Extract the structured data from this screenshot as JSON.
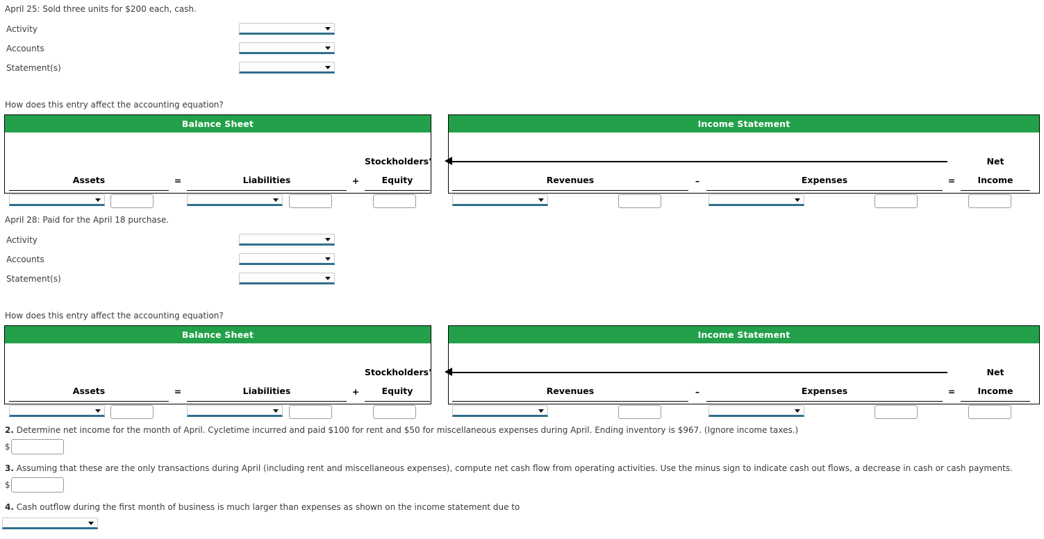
{
  "theme": {
    "header_green": "#22a14a",
    "select_underline": "#2e6e8e",
    "text": "#3a3a3a"
  },
  "transactions": [
    {
      "title": "April 25: Sold three units for $200 each, cash.",
      "fields": [
        {
          "label": "Activity",
          "value": "",
          "icon": "chevron-down-icon"
        },
        {
          "label": "Accounts",
          "value": "",
          "icon": "chevron-down-icon"
        },
        {
          "label": "Statement(s)",
          "value": "",
          "icon": "chevron-down-icon"
        }
      ],
      "prompt": "How does this entry affect the accounting equation?"
    },
    {
      "title": "April 28: Paid for the April 18 purchase.",
      "fields": [
        {
          "label": "Activity",
          "value": "",
          "icon": "chevron-down-icon"
        },
        {
          "label": "Accounts",
          "value": "",
          "icon": "chevron-down-icon"
        },
        {
          "label": "Statement(s)",
          "value": "",
          "icon": "chevron-down-icon"
        }
      ],
      "prompt": "How does this entry affect the accounting equation?"
    }
  ],
  "equation_table": {
    "balance_sheet": {
      "header": "Balance Sheet",
      "columns": [
        {
          "label": "Assets",
          "line1": "",
          "line2": "Assets"
        },
        {
          "label": "Liabilities",
          "line1": "",
          "line2": "Liabilities"
        },
        {
          "label": "Stockholders' Equity",
          "line1": "Stockholders'",
          "line2": "Equity"
        }
      ],
      "operators": [
        "=",
        "+"
      ],
      "cells": {
        "assets_select": "",
        "assets_amount": "",
        "liabilities_select": "",
        "liabilities_amount": "",
        "equity_amount": ""
      }
    },
    "income_statement": {
      "header": "Income Statement",
      "columns": [
        {
          "label": "Revenues",
          "line1": "",
          "line2": "Revenues"
        },
        {
          "label": "Expenses",
          "line1": "",
          "line2": "Expenses"
        },
        {
          "label": "Net Income",
          "line1": "Net",
          "line2": "Income"
        }
      ],
      "operators": [
        "–",
        "="
      ],
      "cells": {
        "revenues_select": "",
        "revenues_amount": "",
        "expenses_select": "",
        "expenses_amount": "",
        "net_income_amount": ""
      }
    }
  },
  "questions": [
    {
      "number": "2.",
      "text": "Determine net income for the month of April. Cycletime incurred and paid $100 for rent and $50 for miscellaneous expenses during April. Ending inventory is $967. (Ignore income taxes.)",
      "answer_prefix": "$",
      "answer_value": ""
    },
    {
      "number": "3.",
      "text": "Assuming that these are the only transactions during April (including rent and miscellaneous expenses), compute net cash flow from operating activities. Use the minus sign to indicate cash out flows, a decrease in cash or cash payments.",
      "answer_prefix": "$",
      "answer_value": ""
    },
    {
      "number": "4.",
      "text": "Cash outflow during the first month of business is much larger than expenses as shown on the income statement due to",
      "answer_value": ""
    }
  ]
}
